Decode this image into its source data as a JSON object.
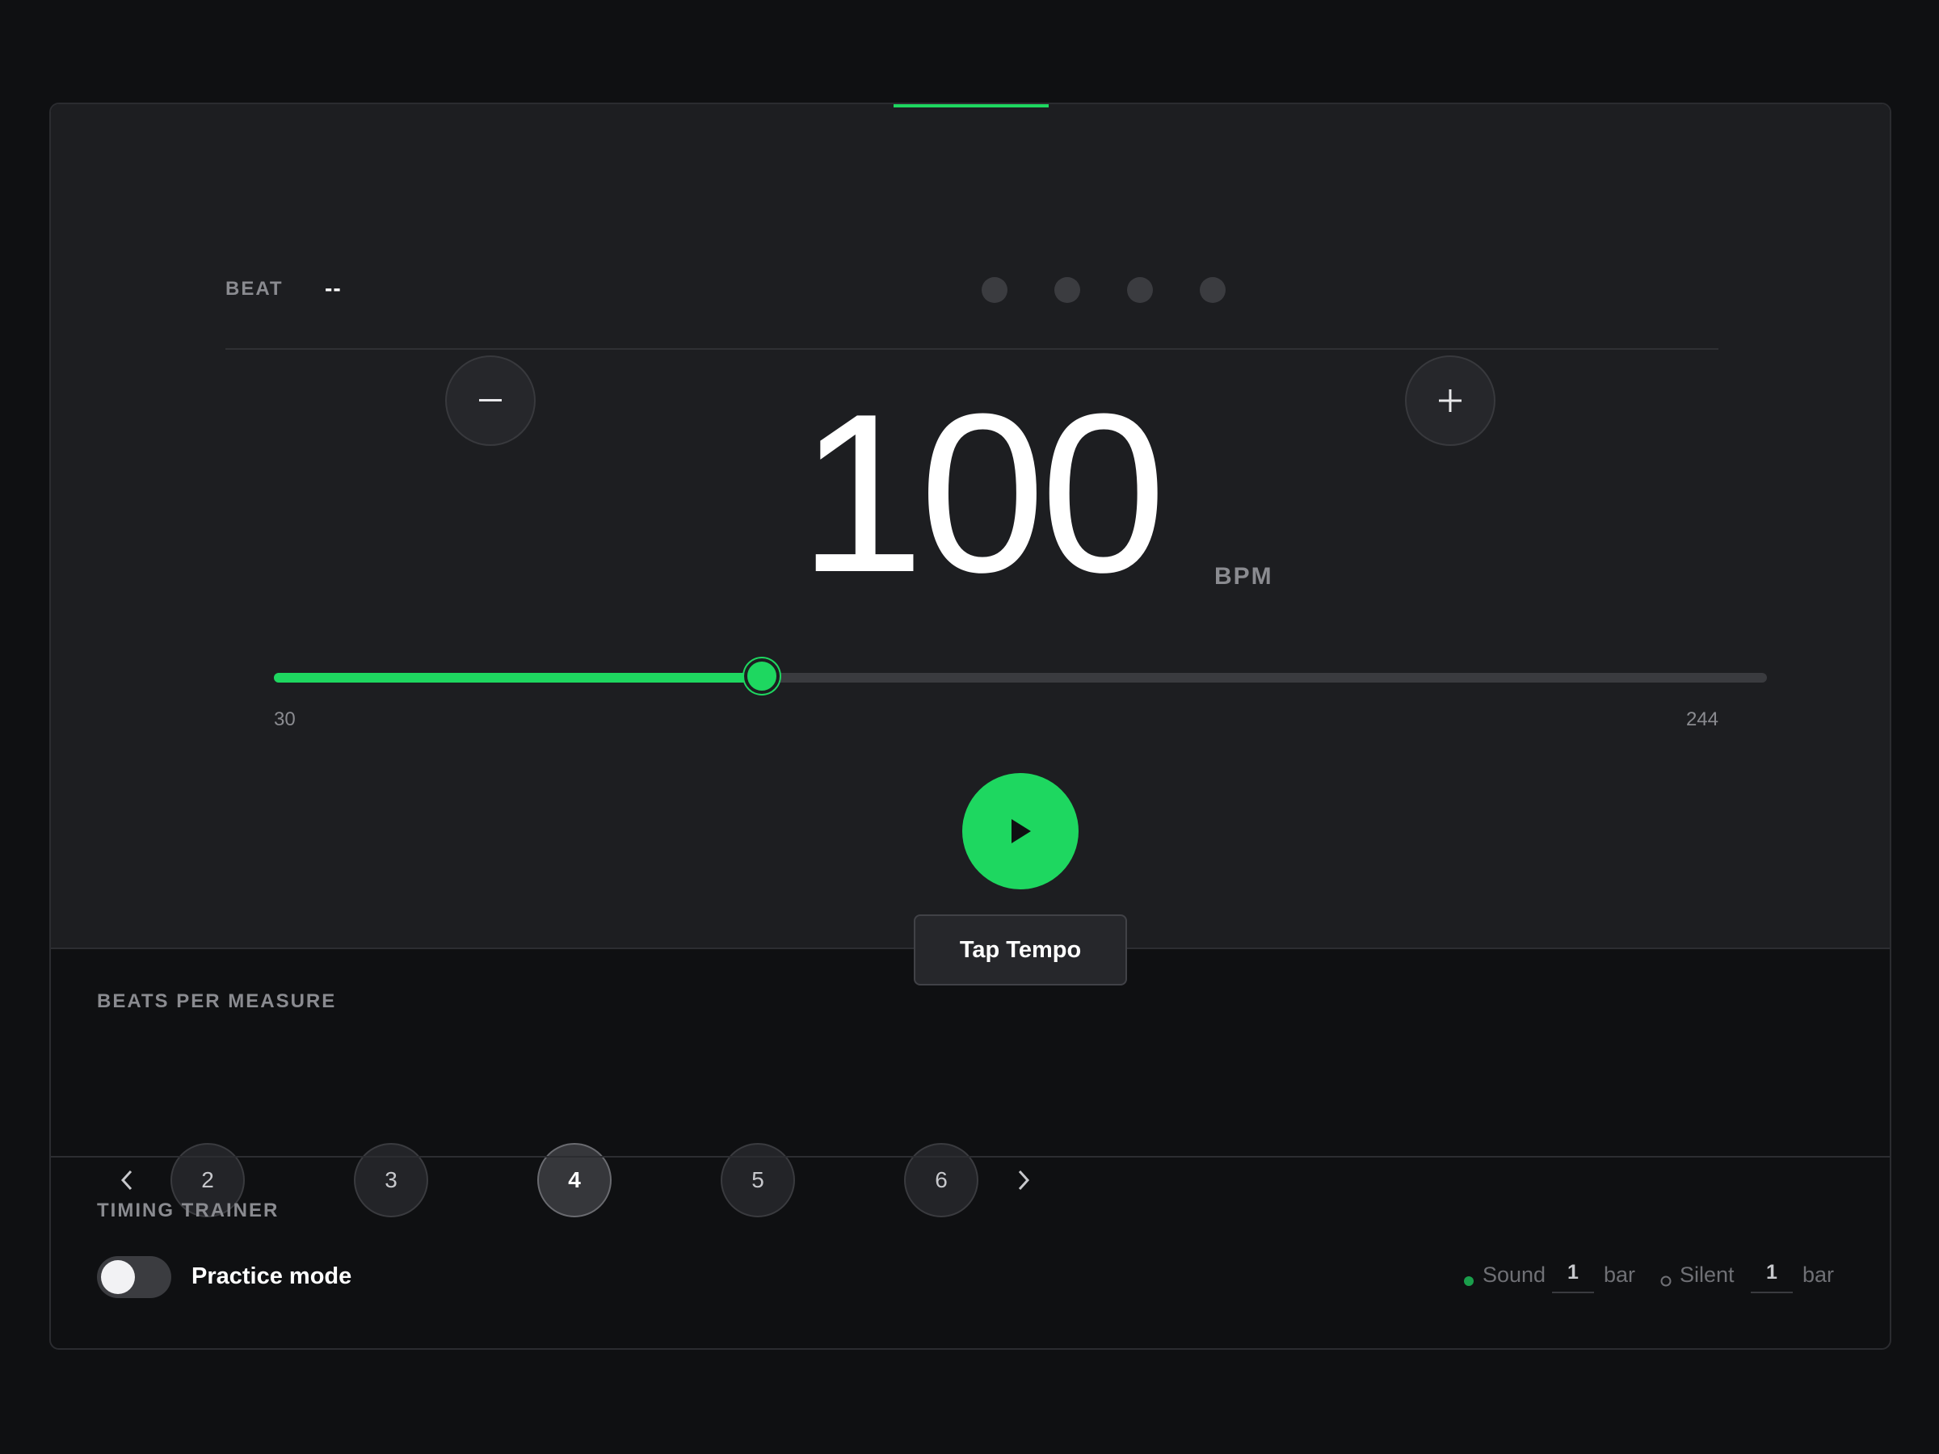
{
  "beat": {
    "label": "BEAT",
    "value": "--",
    "indicator_count": 4
  },
  "tempo": {
    "bpm": "100",
    "unit": "BPM",
    "decrement_label": "−",
    "increment_label": "+",
    "slider": {
      "min_label": "30",
      "max_label": "244",
      "min": 30,
      "max": 244,
      "value": 100
    }
  },
  "transport": {
    "play_icon": "play-icon",
    "tap_tempo_label": "Tap Tempo"
  },
  "beats_per_measure": {
    "label": "BEATS PER MEASURE",
    "options": [
      "2",
      "3",
      "4",
      "5",
      "6"
    ],
    "selected": "4"
  },
  "timing_trainer": {
    "label": "TIMING TRAINER",
    "toggle_label": "Practice mode",
    "toggle_on": false,
    "sound_label": "Sound",
    "sound_bars": "1",
    "silent_label": "Silent",
    "silent_bars": "1",
    "bar_unit": "bar"
  },
  "colors": {
    "accent": "#1ed760",
    "background": "#0f1012",
    "panel": "#1d1e21"
  }
}
